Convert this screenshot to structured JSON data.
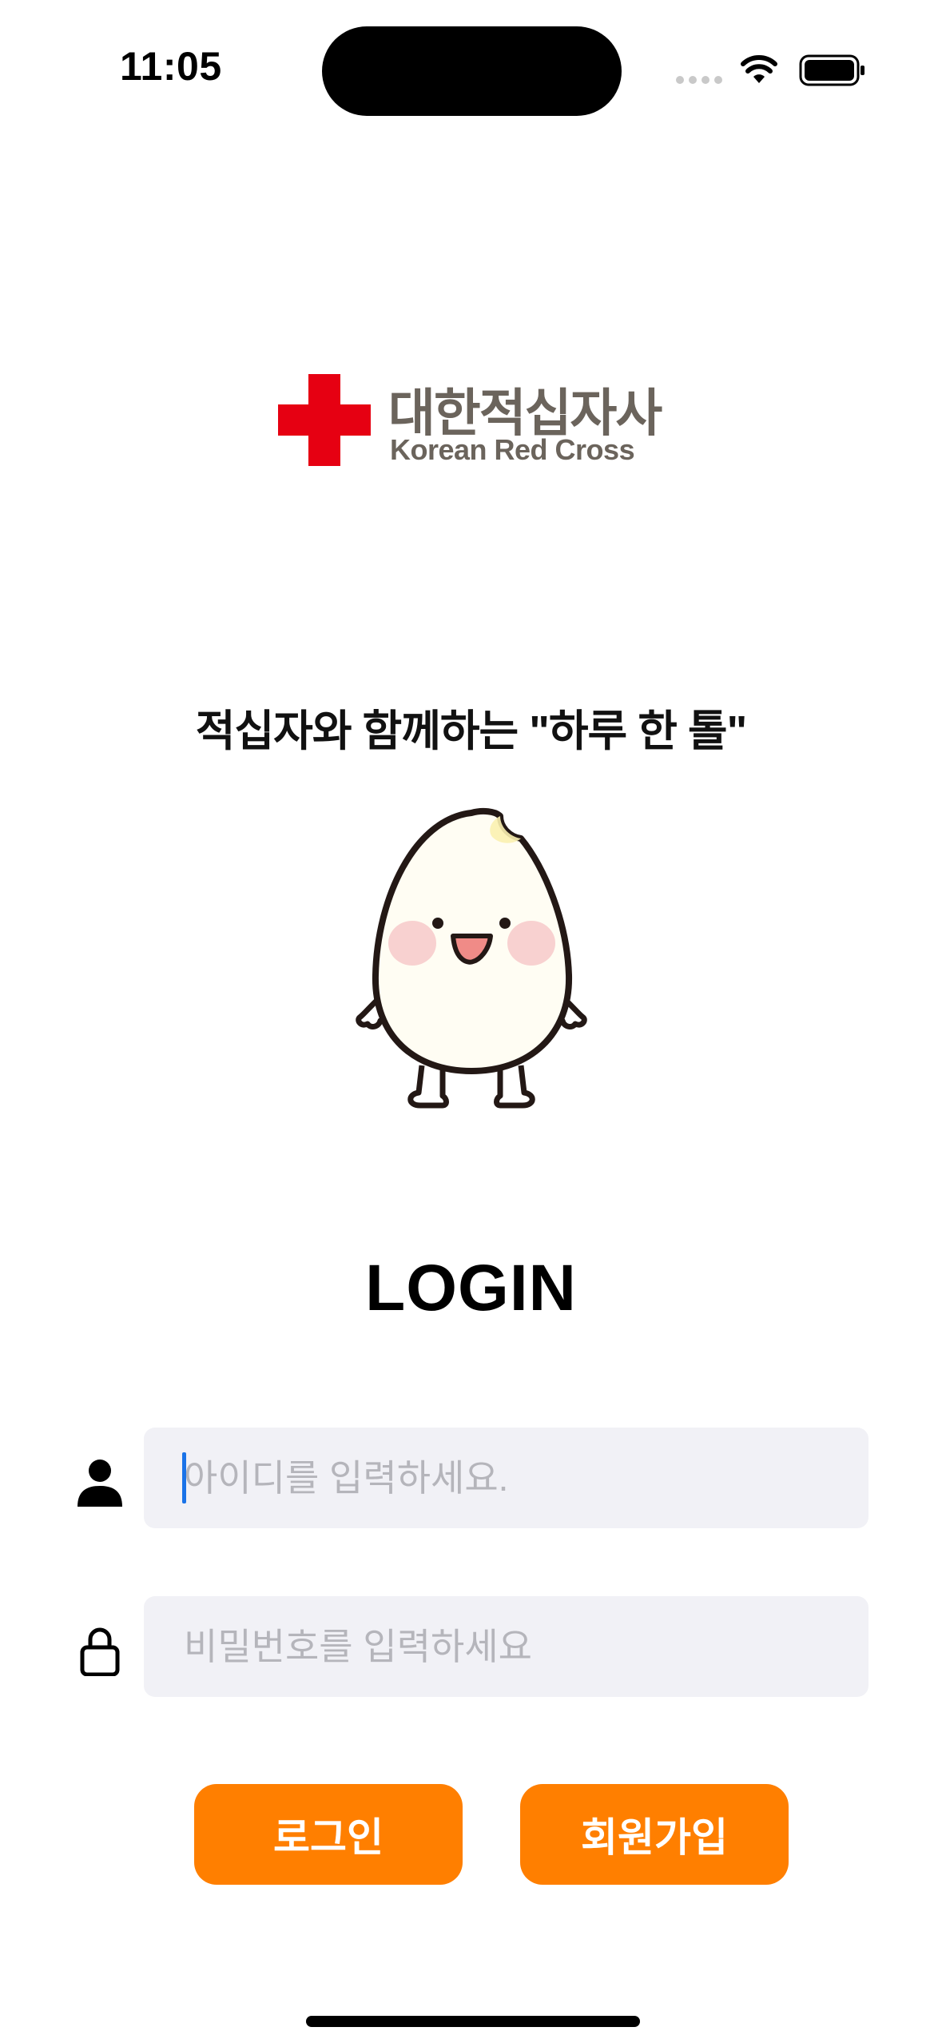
{
  "status_bar": {
    "time": "11:05",
    "signal_icon": "signal-dots-icon",
    "wifi_icon": "wifi-icon",
    "battery_icon": "battery-icon"
  },
  "logo": {
    "name_ko": "대한적십자사",
    "name_en": "Korean Red Cross",
    "cross_color": "#e60012",
    "text_color": "#6b645c"
  },
  "tagline": "적십자와 함께하는 \"하루 한 톨\"",
  "mascot": "rice-grain-mascot",
  "login": {
    "title": "LOGIN",
    "id_field": {
      "placeholder": "아이디를 입력하세요.",
      "value": "",
      "icon": "user-icon"
    },
    "password_field": {
      "placeholder": "비밀번호를 입력하세요",
      "value": "",
      "icon": "lock-icon"
    },
    "login_button": "로그인",
    "signup_button": "회원가입",
    "accent_color": "#ff7f00"
  }
}
